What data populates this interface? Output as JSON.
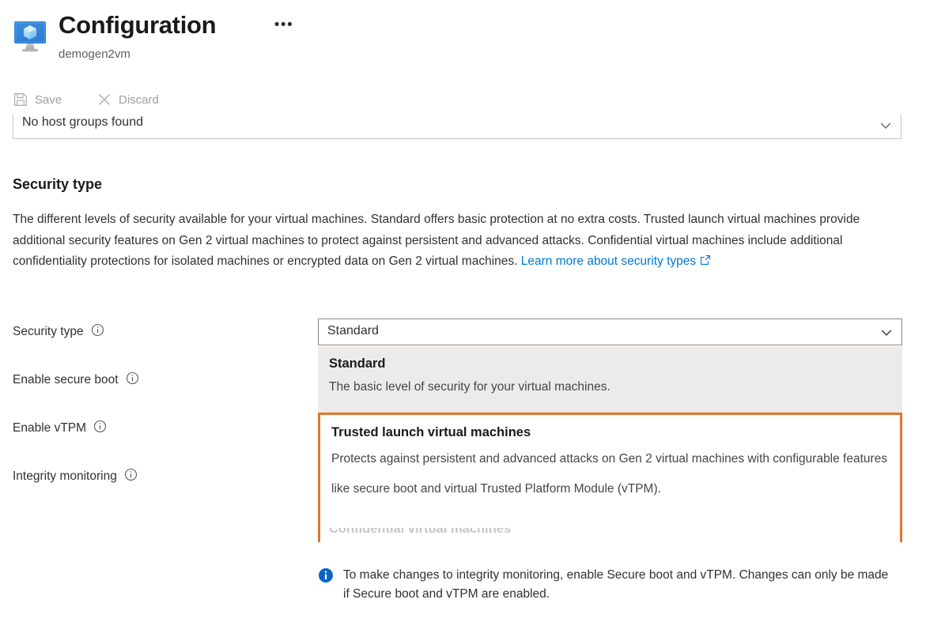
{
  "header": {
    "title": "Configuration",
    "subtitle": "demogen2vm",
    "more_menu_label": "•••",
    "icon": "virtual-machine-icon"
  },
  "commandbar": {
    "save_label": "Save",
    "save_icon": "save-icon",
    "discard_label": "Discard",
    "discard_icon": "close-icon"
  },
  "host_group": {
    "value": "No host groups found",
    "chevron_icon": "chevron-down-icon"
  },
  "security_section": {
    "heading": "Security type",
    "description_part1": "The different levels of security available for your virtual machines. Standard offers basic protection at no extra costs. Trusted launch virtual machines provide additional security features on Gen 2 virtual machines to protect against persistent and advanced attacks. Confidential virtual machines include additional confidentiality protections for isolated machines or encrypted data on Gen 2 virtual machines. ",
    "link_text": "Learn more about security types",
    "link_icon": "external-link-icon"
  },
  "form": {
    "labels": [
      {
        "text": "Security type",
        "info_icon": "info-icon"
      },
      {
        "text": "Enable secure boot",
        "info_icon": "info-icon"
      },
      {
        "text": "Enable vTPM",
        "info_icon": "info-icon"
      },
      {
        "text": "Integrity monitoring",
        "info_icon": "info-icon"
      }
    ]
  },
  "security_type_combobox": {
    "selected_value": "Standard",
    "chevron_icon": "chevron-down-icon",
    "expanded": true,
    "options": [
      {
        "title": "Standard",
        "description": "The basic level of security for your virtual machines.",
        "state": "selected"
      },
      {
        "title": "Trusted launch virtual machines",
        "description": "Protects against persistent and advanced attacks on Gen 2 virtual machines with configurable features like secure boot and virtual Trusted Platform Module (vTPM).",
        "state": "highlighted"
      },
      {
        "title": "Confidential virtual machines",
        "description": "",
        "state": "clipped"
      }
    ]
  },
  "info_message": {
    "icon": "info-filled-icon",
    "text": "To make changes to integrity monitoring, enable Secure boot and vTPM. Changes can only be made if Secure boot and vTPM are enabled."
  },
  "colors": {
    "accent_blue": "#0078d4",
    "highlight_orange": "#e3762a",
    "option_selected_bg": "#edebe9",
    "text_primary": "#323130",
    "text_secondary": "#605e5c",
    "disabled_text": "#a19f9d"
  }
}
